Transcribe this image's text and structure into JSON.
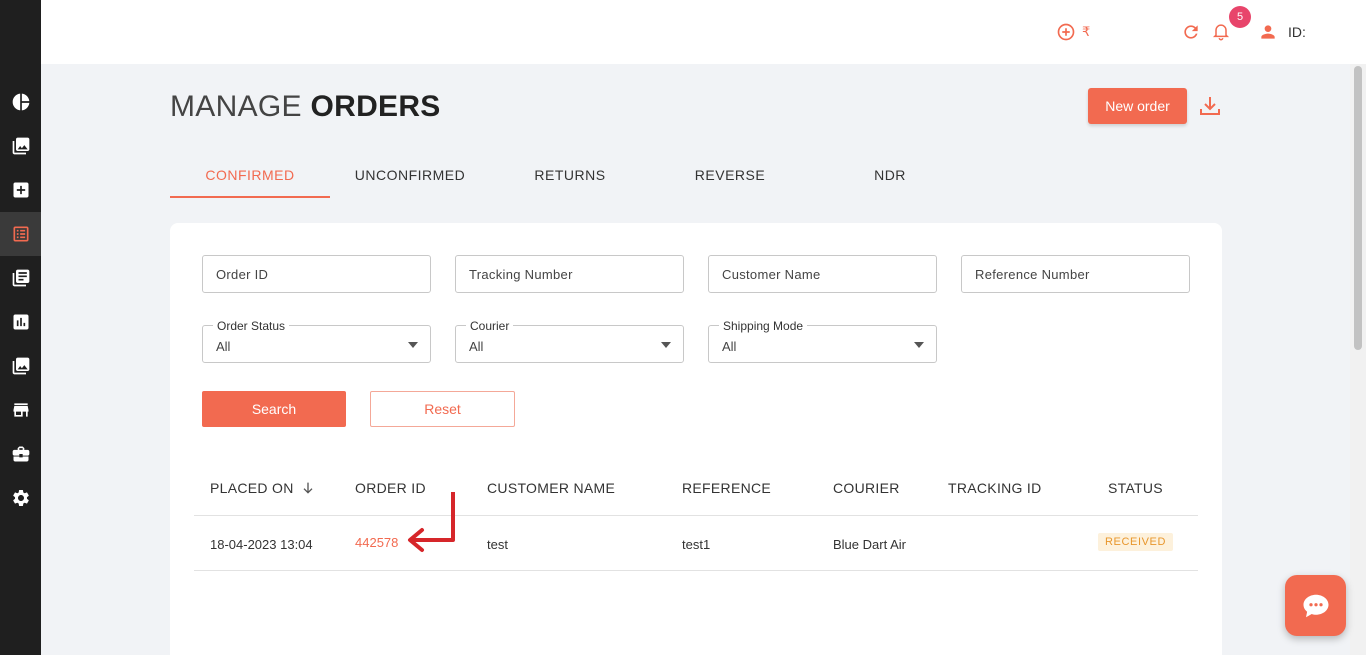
{
  "topbar": {
    "rupee_symbol": "₹",
    "notification_count": "5",
    "user_id_label": "ID:"
  },
  "page": {
    "title_light": "MANAGE",
    "title_bold": "ORDERS",
    "new_order_label": "New order"
  },
  "tabs": [
    {
      "label": "CONFIRMED",
      "active": true
    },
    {
      "label": "UNCONFIRMED",
      "active": false
    },
    {
      "label": "RETURNS",
      "active": false
    },
    {
      "label": "REVERSE",
      "active": false
    },
    {
      "label": "NDR",
      "active": false
    }
  ],
  "filters": {
    "order_id_placeholder": "Order ID",
    "tracking_placeholder": "Tracking Number",
    "customer_placeholder": "Customer Name",
    "reference_placeholder": "Reference Number",
    "order_status": {
      "label": "Order Status",
      "value": "All"
    },
    "courier": {
      "label": "Courier",
      "value": "All"
    },
    "shipping_mode": {
      "label": "Shipping Mode",
      "value": "All"
    },
    "search_label": "Search",
    "reset_label": "Reset"
  },
  "table": {
    "headers": [
      "PLACED ON",
      "ORDER ID",
      "CUSTOMER NAME",
      "REFERENCE",
      "COURIER",
      "TRACKING ID",
      "STATUS"
    ],
    "rows": [
      {
        "placed_on": "18-04-2023 13:04",
        "order_id": "442578",
        "customer_name": "test",
        "reference": "test1",
        "courier": "Blue Dart Air",
        "tracking_id": "",
        "status": "RECEIVED"
      }
    ]
  },
  "colors": {
    "accent": "#f26a50",
    "sidebar": "#1f1f1f",
    "badge": "#e8456b",
    "status_received_bg": "#fdf1dc",
    "status_received_fg": "#e8962c",
    "annotation_arrow": "#d6262a"
  },
  "icons": {
    "sidebar": [
      "pie-chart-icon",
      "images-icon",
      "add-box-icon",
      "list-icon",
      "library-icon",
      "bar-chart-icon",
      "gallery-icon",
      "store-icon",
      "briefcase-icon",
      "settings-icon"
    ],
    "topbar": [
      "add-circle-icon",
      "refresh-icon",
      "bell-icon",
      "user-icon"
    ]
  }
}
